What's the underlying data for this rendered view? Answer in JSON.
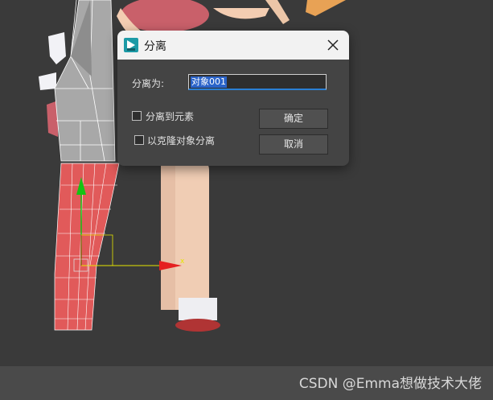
{
  "dialog": {
    "title": "分离",
    "name_label": "分离为:",
    "name_value": "对象001",
    "detach_to_element_label": "分离到元素",
    "detach_as_clone_label": "以克隆对象分离",
    "detach_to_element_checked": false,
    "detach_as_clone_checked": false,
    "ok_label": "确定",
    "cancel_label": "取消"
  },
  "icons": {
    "app": "3dsmax-app-icon",
    "close": "close-icon",
    "gizmo": "move-gizmo-icon"
  },
  "colors": {
    "selected_mesh": "#e15a5a",
    "gizmo_y": "#13c313",
    "gizmo_x": "#e52020",
    "selection_highlight": "#2a63c9"
  },
  "watermark": "CSDN @Emma想做技术大佬"
}
